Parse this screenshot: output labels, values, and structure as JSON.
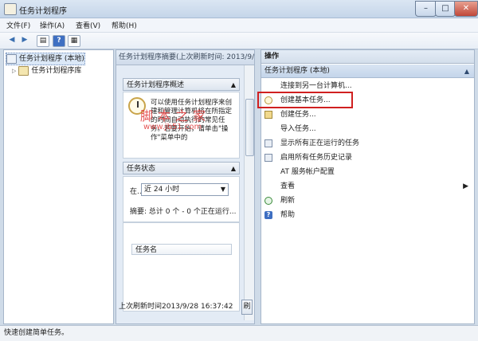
{
  "window": {
    "title": "任务计划程序",
    "controls": {
      "minimize": "–",
      "maximize": "□",
      "close": "✕"
    }
  },
  "menubar": [
    "文件(F)",
    "操作(A)",
    "查看(V)",
    "帮助(H)"
  ],
  "toolbar": {
    "icons": [
      "back-icon",
      "forward-icon",
      "panel-icon",
      "help-icon",
      "console-icon"
    ],
    "glyphs": {
      "back": "◀",
      "forward": "▶",
      "panel": "▤",
      "help": "?",
      "console": "▦"
    }
  },
  "tree": {
    "items": [
      {
        "label": "任务计划程序 (本地)",
        "selected": true
      },
      {
        "label": "任务计划程序库",
        "expander": "▷"
      }
    ]
  },
  "middle": {
    "header": "任务计划程序摘要(上次刷新时间: 2013/9/28",
    "overview": {
      "title": "任务计划程序概述",
      "text": "可以使用任务计划程序来创建和管理计算机将在所指定的时间自动执行的常见任务。若要开始，请单击\"操作\"菜单中的"
    },
    "status": {
      "title": "任务状态",
      "range_label": "在...",
      "range_value": "近 24 小时",
      "summary": "摘要: 总计 0 个 - 0 个正在运行...",
      "table_header": "任务名"
    },
    "last_refresh": "上次刷新时间2013/9/28 16:37:42",
    "refresh_button": "刷",
    "chevron_up": "▲",
    "dropdown_arrow": "▼"
  },
  "actions": {
    "title": "操作",
    "group": "任务计划程序 (本地)",
    "group_arrow": "▲",
    "items": [
      {
        "label": "连接到另一台计算机...",
        "icon": "none"
      },
      {
        "label": "创建基本任务...",
        "icon": "clock-icon",
        "highlighted": true
      },
      {
        "label": "创建任务...",
        "icon": "task-icon"
      },
      {
        "label": "导入任务...",
        "icon": "none"
      },
      {
        "label": "显示所有正在运行的任务",
        "icon": "grid-icon"
      },
      {
        "label": "启用所有任务历史记录",
        "icon": "grid-icon"
      },
      {
        "label": "AT 服务帐户配置",
        "icon": "none"
      },
      {
        "label": "查看",
        "icon": "none",
        "submenu_arrow": "▶"
      },
      {
        "label": "刷新",
        "icon": "refresh-icon"
      },
      {
        "label": "帮助",
        "icon": "help-icon",
        "glyph": "?"
      }
    ]
  },
  "statusbar": {
    "text": "快速创建简单任务。"
  },
  "watermark": {
    "text": "脚本之家",
    "url": "www.jb51.com"
  },
  "colors": {
    "highlight": "#d02020",
    "accent": "#3e6fc2",
    "watermark": "#e23a3a"
  }
}
